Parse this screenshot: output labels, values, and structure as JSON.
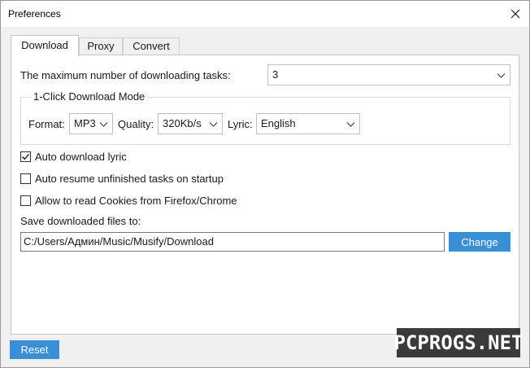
{
  "window": {
    "title": "Preferences"
  },
  "tabs": [
    {
      "label": "Download"
    },
    {
      "label": "Proxy"
    },
    {
      "label": "Convert"
    }
  ],
  "download": {
    "max_tasks_label": "The maximum number of downloading tasks:",
    "max_tasks_value": "3",
    "one_click_title": "1-Click Download Mode",
    "format_label": "Format:",
    "format_value": "MP3",
    "quality_label": "Quality:",
    "quality_value": "320Kb/s",
    "lyric_label": "Lyric:",
    "lyric_value": "English",
    "options": [
      {
        "label": "Auto download lyric",
        "checked": true
      },
      {
        "label": "Auto resume unfinished tasks on startup",
        "checked": false
      },
      {
        "label": "Allow to read Cookies from Firefox/Chrome",
        "checked": false
      }
    ],
    "save_label": "Save downloaded files to:",
    "save_path": "C:/Users/Админ/Music/Musify/Download",
    "change_button": "Change"
  },
  "footer": {
    "reset_button": "Reset"
  },
  "watermark": "PCPROGS.NET",
  "colors": {
    "accent": "#3a8ed4"
  }
}
